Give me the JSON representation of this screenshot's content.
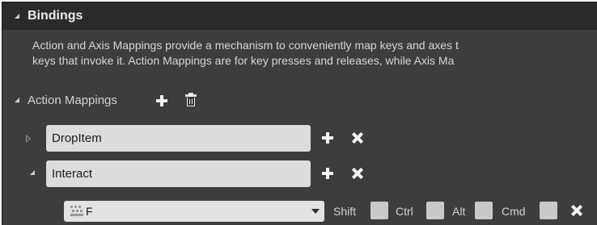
{
  "section": {
    "title": "Bindings"
  },
  "description": {
    "line1": "Action and Axis Mappings provide a mechanism to conveniently map keys and axes t",
    "line2": "keys that invoke it. Action Mappings are for key presses and releases, while Axis Ma"
  },
  "action_mappings": {
    "label": "Action Mappings",
    "items": [
      {
        "name": "DropItem",
        "expanded": false
      },
      {
        "name": "Interact",
        "expanded": true,
        "key": {
          "value": "F",
          "modifiers": [
            "Shift",
            "Ctrl",
            "Alt",
            "Cmd"
          ]
        }
      }
    ]
  }
}
